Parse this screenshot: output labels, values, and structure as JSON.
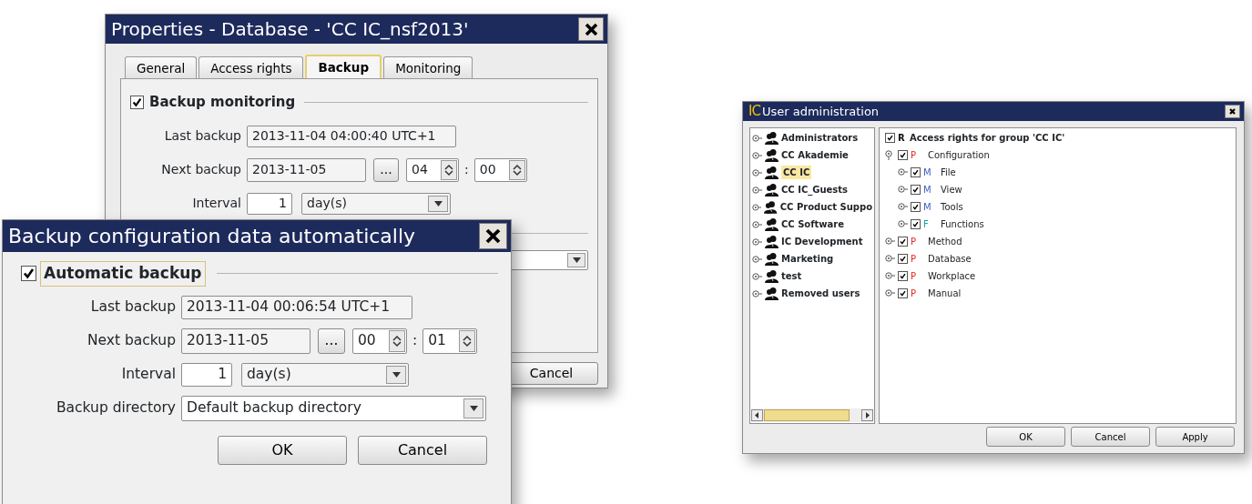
{
  "properties_dialog": {
    "title": "Properties - Database - 'CC IC_nsf2013'",
    "tabs": [
      {
        "label": "General",
        "selected": false
      },
      {
        "label": "Access rights",
        "selected": false
      },
      {
        "label": "Backup",
        "selected": true
      },
      {
        "label": "Monitoring",
        "selected": false
      }
    ],
    "backup_monitoring": {
      "label": "Backup monitoring",
      "checked": true
    },
    "last_backup": {
      "label": "Last backup",
      "value": "2013-11-04 04:00:40 UTC+1"
    },
    "next_backup": {
      "label": "Next backup",
      "date": "2013-11-05",
      "picker": "...",
      "hour": "04",
      "separator": ":",
      "minute": "00"
    },
    "interval": {
      "label": "Interval",
      "value": "1",
      "unit": "day(s)"
    },
    "buttons": [
      {
        "label": "Cancel"
      }
    ]
  },
  "backup_dialog": {
    "title": "Backup configuration data automatically",
    "automatic_backup": {
      "label": "Automatic backup",
      "checked": true
    },
    "last_backup": {
      "label": "Last backup",
      "value": "2013-11-04 00:06:54 UTC+1"
    },
    "next_backup": {
      "label": "Next backup",
      "date": "2013-11-05",
      "picker": "...",
      "hour": "00",
      "separator": ":",
      "minute": "01"
    },
    "interval": {
      "label": "Interval",
      "value": "1",
      "unit": "day(s)"
    },
    "backup_directory": {
      "label": "Backup directory",
      "value": "Default backup directory"
    },
    "buttons": [
      {
        "label": "OK"
      },
      {
        "label": "Cancel"
      }
    ]
  },
  "user_admin": {
    "logo": "IC",
    "title": "User administration",
    "groups": [
      {
        "label": "Administrators",
        "selected": false
      },
      {
        "label": "CC Akademie",
        "selected": false
      },
      {
        "label": "CC IC",
        "selected": true
      },
      {
        "label": "CC IC_Guests",
        "selected": false
      },
      {
        "label": "CC Product Suppo",
        "selected": false
      },
      {
        "label": "CC Software",
        "selected": false
      },
      {
        "label": "IC Development",
        "selected": false
      },
      {
        "label": "Marketing",
        "selected": false
      },
      {
        "label": "test",
        "selected": false
      },
      {
        "label": "Removed users",
        "selected": false
      }
    ],
    "rights": {
      "letter": "R",
      "color": "#111111",
      "label": "Access rights for group 'CC IC'",
      "checked": true,
      "children": [
        {
          "letter": "P",
          "color": "#e8261f",
          "label": "Configuration",
          "checked": true,
          "expanded": true,
          "children": [
            {
              "letter": "M",
              "color": "#3b5fc4",
              "label": "File",
              "checked": true,
              "expanded": false
            },
            {
              "letter": "M",
              "color": "#3b5fc4",
              "label": "View",
              "checked": true,
              "expanded": false
            },
            {
              "letter": "M",
              "color": "#3b5fc4",
              "label": "Tools",
              "checked": true,
              "expanded": false
            },
            {
              "letter": "F",
              "color": "#18a0a8",
              "label": "Functions",
              "checked": true,
              "expanded": false
            }
          ]
        },
        {
          "letter": "P",
          "color": "#e8261f",
          "label": "Method",
          "checked": true,
          "expanded": false
        },
        {
          "letter": "P",
          "color": "#e8261f",
          "label": "Database",
          "checked": true,
          "expanded": false
        },
        {
          "letter": "P",
          "color": "#e8261f",
          "label": "Workplace",
          "checked": true,
          "expanded": false
        },
        {
          "letter": "P",
          "color": "#e8261f",
          "label": "Manual",
          "checked": true,
          "expanded": false
        }
      ]
    },
    "buttons": [
      {
        "label": "OK"
      },
      {
        "label": "Cancel"
      },
      {
        "label": "Apply"
      }
    ]
  }
}
